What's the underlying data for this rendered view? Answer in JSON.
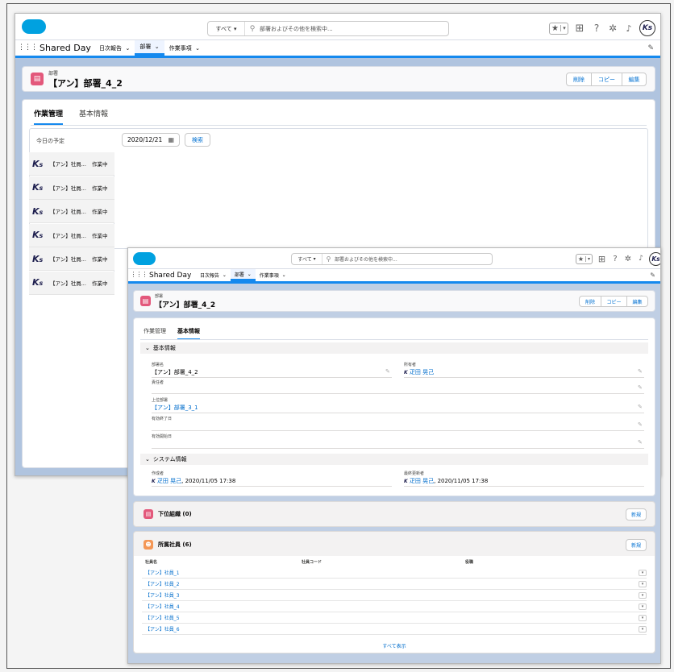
{
  "app": {
    "search_scope": "すべて",
    "search_placeholder": "部署およびその他を検索中...",
    "app_name": "Shared Day",
    "nav_items": [
      "日次報告",
      "部署",
      "作業事項"
    ],
    "avatar_text": "Ks",
    "icons": [
      "salesforce-cloud-icon",
      "favorite-star-icon",
      "favorites-list-icon",
      "add-icon",
      "help-icon",
      "setup-gear-icon",
      "notification-bell-icon",
      "app-launcher-waffle-icon",
      "edit-pencil-icon"
    ],
    "colors": {
      "brand_blue": "#00a1e0",
      "accent": "#1589ee",
      "record_icon": "#e3587b",
      "link": "#006dcc"
    }
  },
  "record": {
    "type_label": "部署",
    "title": "【アン】部署_4_2",
    "actions": [
      "削除",
      "コピー",
      "編集"
    ]
  },
  "tabs": [
    "作業管理",
    "基本情報"
  ],
  "screen1": {
    "active_tab": "作業管理",
    "schedule_label": "今日の予定",
    "date_value": "2020/12/21",
    "calendar_icon": "calendar-icon",
    "search_button": "検索",
    "employees": [
      {
        "name": "【アン】社員...",
        "status": "作業中"
      },
      {
        "name": "【アン】社員...",
        "status": "作業中"
      },
      {
        "name": "【アン】社員...",
        "status": "作業中"
      },
      {
        "name": "【アン】社員...",
        "status": "作業中"
      },
      {
        "name": "【アン】社員...",
        "status": "作業中"
      },
      {
        "name": "【アン】社員...",
        "status": "作業中"
      }
    ]
  },
  "screen2": {
    "active_tab": "基本情報",
    "section_basic": "基本情報",
    "fields": {
      "dept_name_label": "部署名",
      "dept_name_value": "【アン】部署_4_2",
      "owner_label": "所有者",
      "owner_value": "疋田 晃己",
      "responsible_label": "責任者",
      "parent_label": "上位部署",
      "parent_value": "【アン】部署_3_1",
      "end_date_label": "有効終了日",
      "start_date_label": "有効開始日"
    },
    "section_system": "システム情報",
    "system": {
      "created_label": "作成者",
      "created_user": "疋田 晃己",
      "created_at": ", 2020/11/05 17:38",
      "modified_label": "最終更新者",
      "modified_user": "疋田 晃己",
      "modified_at": ", 2020/11/05 17:38"
    },
    "sub_org": {
      "title": "下位組織 (0)",
      "new_button": "新規"
    },
    "members": {
      "title": "所属社員 (6)",
      "new_button": "新規",
      "columns": [
        "社員名",
        "社員コード",
        "役職"
      ],
      "rows": [
        "【アン】社員_1",
        "【アン】社員_2",
        "【アン】社員_3",
        "【アン】社員_4",
        "【アン】社員_5",
        "【アン】社員_6"
      ],
      "view_all": "すべて表示"
    }
  }
}
